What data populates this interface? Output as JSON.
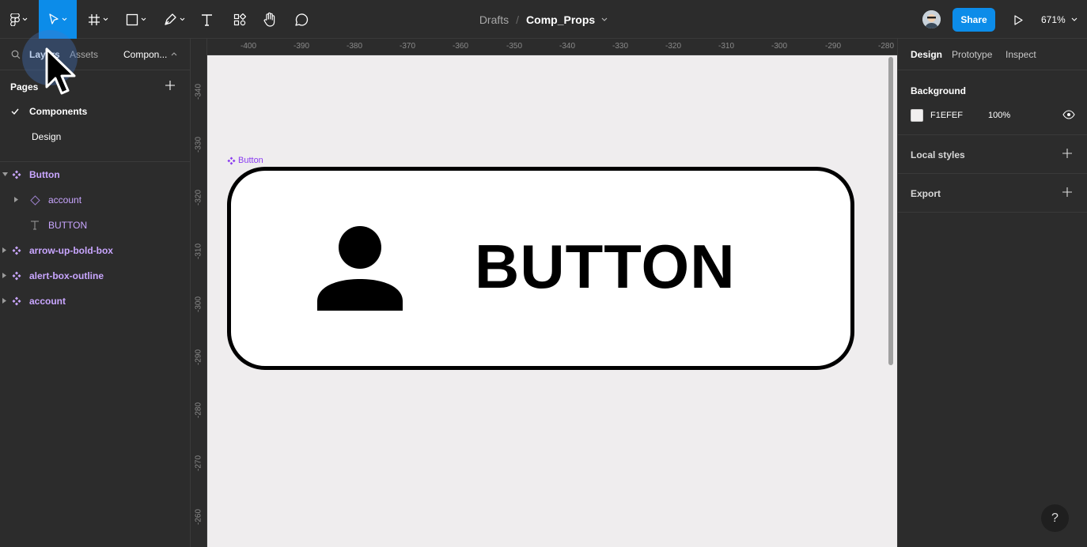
{
  "toolbar": {
    "breadcrumb_parent": "Drafts",
    "breadcrumb_separator": "/",
    "file_name": "Comp_Props",
    "share_label": "Share",
    "zoom_level": "671%",
    "tools": [
      "figma-menu",
      "move",
      "frame",
      "shape",
      "pen",
      "text",
      "resources",
      "hand",
      "comment"
    ]
  },
  "left_panel": {
    "tabs": {
      "layers": "Layers",
      "assets": "Assets",
      "page_selector": "Compon..."
    },
    "pages_heading": "Pages",
    "pages": [
      {
        "label": "Components",
        "selected": true
      },
      {
        "label": "Design",
        "selected": false
      }
    ],
    "layers": [
      {
        "label": "Button",
        "type": "component"
      },
      {
        "label": "account",
        "type": "instance"
      },
      {
        "label": "BUTTON",
        "type": "text"
      },
      {
        "label": "arrow-up-bold-box",
        "type": "component"
      },
      {
        "label": "alert-box-outline",
        "type": "component"
      },
      {
        "label": "account",
        "type": "component"
      }
    ]
  },
  "rulers": {
    "top": [
      "-400",
      "-390",
      "-380",
      "-370",
      "-360",
      "-350",
      "-340",
      "-330",
      "-320",
      "-310",
      "-300",
      "-290",
      "-280"
    ],
    "left": [
      "-340",
      "-330",
      "-320",
      "-310",
      "-300",
      "-290",
      "-280",
      "-270",
      "-260"
    ]
  },
  "canvas": {
    "component_label": "Button",
    "button_text": "BUTTON",
    "background_color": "#F1EFEF"
  },
  "right_panel": {
    "tabs": {
      "design": "Design",
      "prototype": "Prototype",
      "inspect": "Inspect"
    },
    "background_heading": "Background",
    "background_hex": "F1EFEF",
    "background_opacity": "100%",
    "local_styles_heading": "Local styles",
    "export_heading": "Export"
  },
  "help_label": "?",
  "colors": {
    "accent": "#0c8ce9",
    "component_purple": "#c9a6ff",
    "panel_bg": "#2c2c2c"
  }
}
